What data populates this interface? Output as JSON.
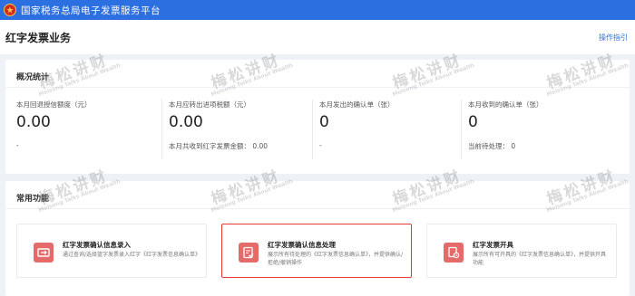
{
  "header": {
    "site_title": "国家税务总局电子发票服务平台"
  },
  "page": {
    "title": "红字发票业务",
    "guide_link": "操作指引"
  },
  "overview": {
    "title": "概况统计",
    "stats": [
      {
        "label": "本月回退授信额度（元）",
        "value": "0.00",
        "sub": "-"
      },
      {
        "label": "本月应转出进项税额（元）",
        "value": "0.00",
        "sub": "本月共收到红字发票金额：  0.00"
      },
      {
        "label": "本月发出的确认单（张）",
        "value": "0",
        "sub": "-"
      },
      {
        "label": "本月收到的确认单（张）",
        "value": "0",
        "sub": "当前待处理：  0"
      }
    ]
  },
  "functions": {
    "title": "常用功能",
    "items": [
      {
        "title": "红字发票确认信息录入",
        "desc": "通过查询/选择蓝字发票录入红字《红字发票信息确认单》",
        "icon": "invoice-entry-icon",
        "active": false
      },
      {
        "title": "红字发票确认信息处理",
        "desc": "展示所有待处理的《红字发票信息确认单》，并提供确认/拒绝/撤销操作",
        "icon": "invoice-process-icon",
        "active": true
      },
      {
        "title": "红字发票开具",
        "desc": "展示所有可开具的《红字发票信息确认单》，并提供开具功能",
        "icon": "invoice-issue-icon",
        "active": false
      }
    ]
  },
  "watermark": {
    "cn": "梅松讲财",
    "en": "Meisong Talks About Wealth"
  },
  "colors": {
    "topbar": "#2c6fe0",
    "accent": "#e53935",
    "icon_bg": "#e56a6a"
  }
}
